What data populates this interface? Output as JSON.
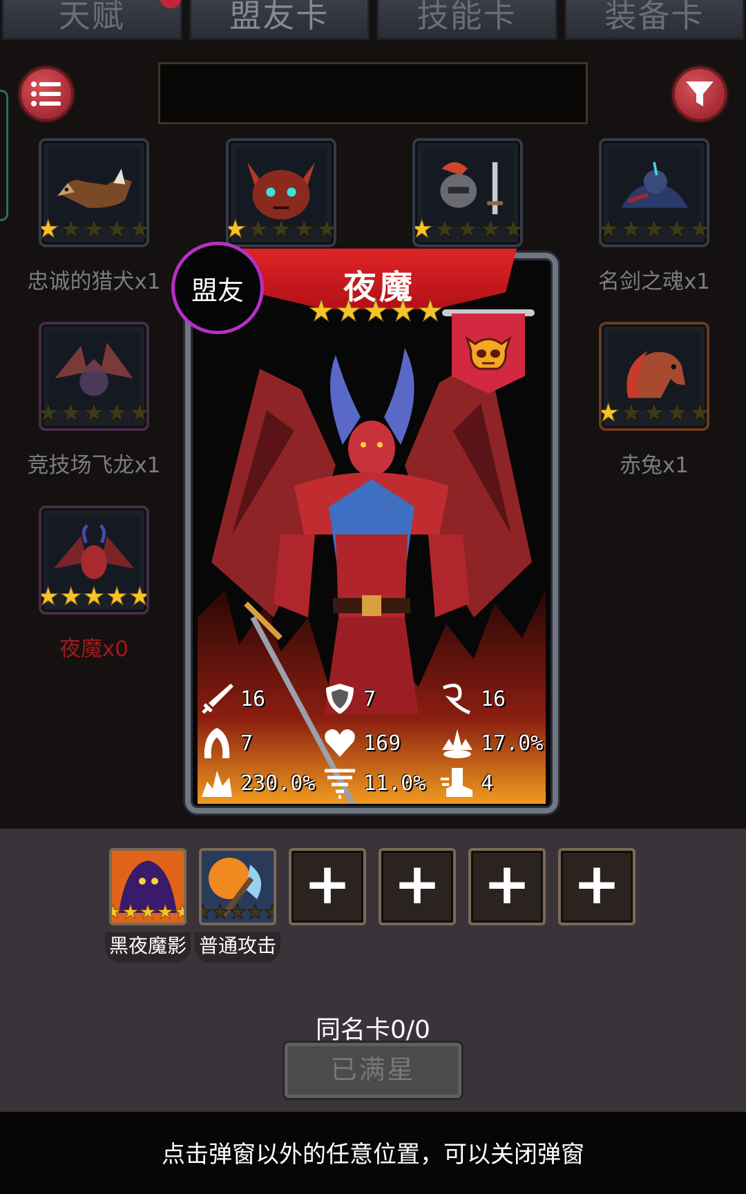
{
  "tabs": [
    {
      "label": "天赋",
      "active": false,
      "has_dot": true
    },
    {
      "label": "盟友卡",
      "active": true,
      "has_dot": false
    },
    {
      "label": "技能卡",
      "active": false,
      "has_dot": false
    },
    {
      "label": "装备卡",
      "active": false,
      "has_dot": false
    }
  ],
  "toolbar": {
    "menu_icon": "list-icon",
    "filter_icon": "filter-icon",
    "search_value": ""
  },
  "cards": [
    {
      "name": "忠诚的猎犬x1",
      "stars": 1,
      "frame": "blue",
      "art": "hound"
    },
    {
      "name": "",
      "stars": 1,
      "frame": "blue",
      "art": "horned-head"
    },
    {
      "name": "",
      "stars": 1,
      "frame": "blue",
      "art": "warrior"
    },
    {
      "name": "名剑之魂x1",
      "stars": 0,
      "frame": "blue",
      "art": "knight"
    },
    {
      "name": "竞技场飞龙x1",
      "stars": 0,
      "frame": "purple",
      "art": "dragon"
    },
    {
      "name": "赤兔x1",
      "stars": 1,
      "frame": "orange",
      "art": "horse"
    },
    {
      "name": "夜魔x0",
      "stars": 5,
      "frame": "purple",
      "art": "demon",
      "owned": false
    }
  ],
  "popup": {
    "badge": "盟友",
    "title": "夜魔",
    "stars": 5,
    "pennant_icon": "skull-icon",
    "stats": [
      {
        "icon": "sword-icon",
        "value": "16"
      },
      {
        "icon": "shield-icon",
        "value": "7"
      },
      {
        "icon": "whip-icon",
        "value": "16"
      },
      {
        "icon": "hood-icon",
        "value": "7"
      },
      {
        "icon": "heart-icon",
        "value": "169"
      },
      {
        "icon": "burst-icon",
        "value": "17.0%"
      },
      {
        "icon": "crit-icon",
        "value": "230.0%"
      },
      {
        "icon": "tornado-icon",
        "value": "11.0%"
      },
      {
        "icon": "boot-icon",
        "value": "4"
      }
    ]
  },
  "skills": [
    {
      "name": "黑夜魔影",
      "stars": 5,
      "art": "shadow"
    },
    {
      "name": "普通攻击",
      "stars": 0,
      "art": "axe"
    },
    {
      "name": "",
      "empty": true
    },
    {
      "name": "",
      "empty": true
    },
    {
      "name": "",
      "empty": true
    },
    {
      "name": "",
      "empty": true
    }
  ],
  "empty_slot_glyph": "+",
  "star_glyph": "★",
  "duplicate_label": "同名卡0/0",
  "max_star_button": "已满星",
  "hint": "点击弹窗以外的任意位置，可以关闭弹窗",
  "colors": {
    "accent_red": "#d22840",
    "star_gold": "#f5c32a",
    "badge_purple": "#b431c2",
    "unowned_label": "#a11820"
  }
}
